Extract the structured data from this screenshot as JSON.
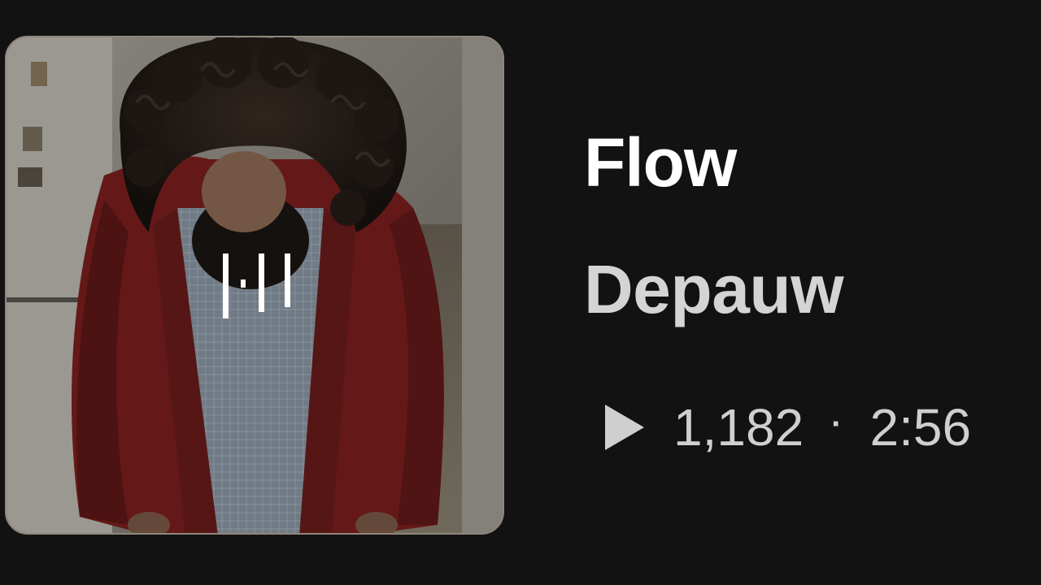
{
  "track": {
    "title": "Flow",
    "artist": "Depauw",
    "plays": "1,182",
    "separator": "·",
    "duration": "2:56"
  },
  "icons": {
    "now_playing": "audio-bars-icon",
    "play_count": "play-icon"
  },
  "colors": {
    "background": "#121212",
    "title": "#ffffff",
    "artist": "#d4d4d4",
    "stats": "#cfcfcf"
  }
}
